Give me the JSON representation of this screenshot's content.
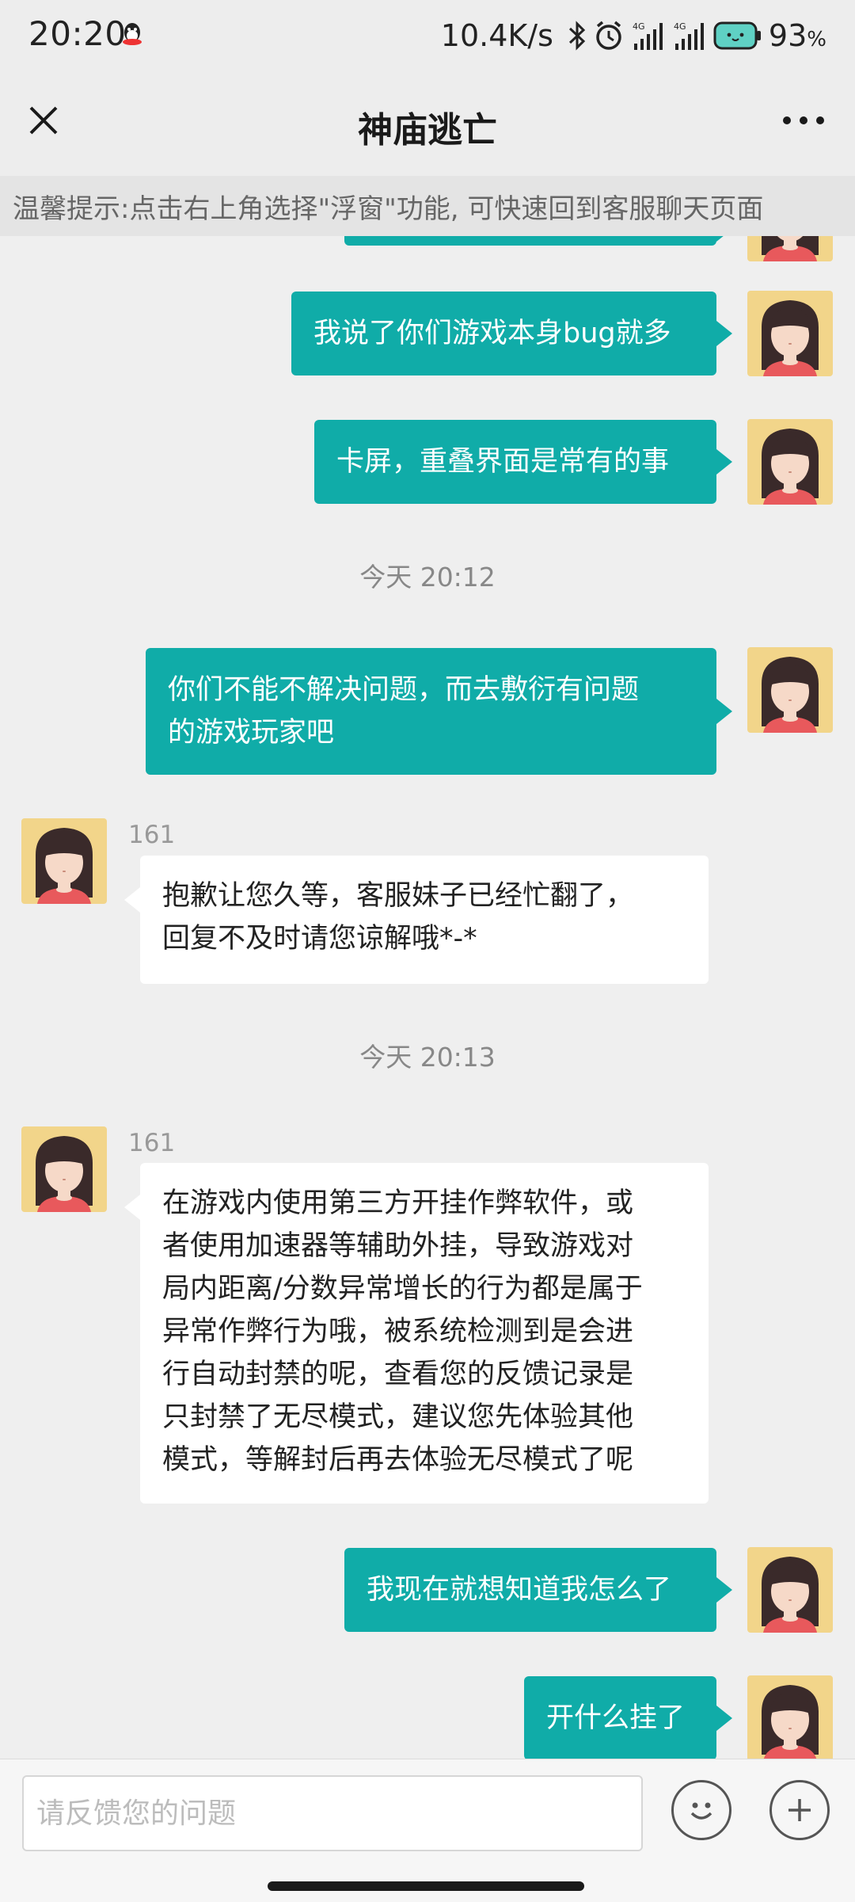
{
  "status_bar": {
    "time": "20:20",
    "network_speed": "10.4K/s",
    "battery_percent": "93",
    "battery_unit": "%",
    "icons": [
      "qq-icon",
      "bluetooth-icon",
      "alarm-icon",
      "signal-4g-icon",
      "signal-4g-icon",
      "battery-icon"
    ]
  },
  "header": {
    "title": "神庙逃亡",
    "close_icon": "close-icon",
    "more_icon": "more-icon"
  },
  "tip": {
    "text": "温馨提示:点击右上角选择\"浮窗\"功能, 可快速回到客服聊天页面"
  },
  "messages": [
    {
      "type": "out",
      "lines": [
        "我说了你们游戏本身bug就多"
      ]
    },
    {
      "type": "out",
      "lines": [
        "卡屏，重叠界面是常有的事"
      ]
    },
    {
      "type": "time",
      "text": "今天 20:12"
    },
    {
      "type": "out",
      "lines": [
        "你们不能不解决问题，而去敷衍有问题",
        "的游戏玩家吧"
      ]
    },
    {
      "type": "in",
      "sender": "161",
      "lines": [
        "抱歉让您久等，客服妹子已经忙翻了，",
        "回复不及时请您谅解哦*-*"
      ]
    },
    {
      "type": "time",
      "text": "今天 20:13"
    },
    {
      "type": "in",
      "sender": "161",
      "lines": [
        "在游戏内使用第三方开挂作弊软件，或",
        "者使用加速器等辅助外挂，导致游戏对",
        "局内距离/分数异常增长的行为都是属于",
        "异常作弊行为哦，被系统检测到是会进",
        "行自动封禁的呢，查看您的反馈记录是",
        "只封禁了无尽模式，建议您先体验其他",
        "模式，等解封后再去体验无尽模式了呢"
      ]
    },
    {
      "type": "out",
      "lines": [
        "我现在就想知道我怎么了"
      ]
    },
    {
      "type": "out",
      "lines": [
        "开什么挂了"
      ]
    }
  ],
  "input": {
    "placeholder": "请反馈您的问题",
    "value": ""
  },
  "colors": {
    "outgoing_bubble": "#10aca8",
    "incoming_bubble": "#ffffff",
    "background": "#efefef"
  }
}
